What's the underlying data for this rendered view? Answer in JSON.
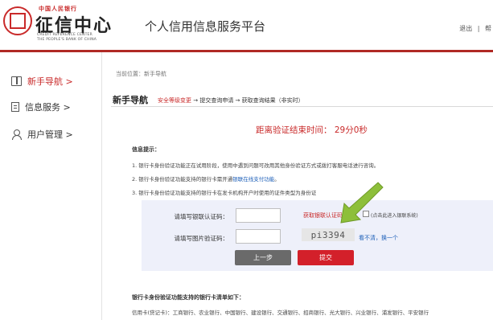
{
  "header": {
    "logo_top": "中国人民银行",
    "logo_cn": "征信中心",
    "logo_en1": "CREDIT REFERENCE CENTER",
    "logo_en2": "THE PEOPLE'S BANK OF CHINA",
    "site_title": "个人信用信息服务平台",
    "links": [
      "退出",
      "|",
      "帮"
    ]
  },
  "sidebar": {
    "items": [
      {
        "label": "新手导航 >",
        "icon": "book-icon",
        "active": true
      },
      {
        "label": "信息服务 >",
        "icon": "document-icon",
        "active": false
      },
      {
        "label": "用户管理 >",
        "icon": "user-icon",
        "active": false
      }
    ]
  },
  "main": {
    "breadcrumb": "当前位置：新手导航",
    "section_title": "新手导航",
    "steps": {
      "current": "安全等级变更",
      "rest": " → 提交查询申请 → 获取查询结果（非实时）"
    },
    "countdown": "距离验证结束时间：  29分0秒",
    "info_head": "信息提示：",
    "info_lines": [
      {
        "text": "1. 银行卡身份验证功能正在试用阶段，使用中遇到问题可改用其他身份验证方式或拨打客服电话进行咨询。"
      },
      {
        "text": "2. 银行卡身份验证功能支持的银行卡需开通",
        "link": "银联在线支付功能",
        "tail": "。"
      },
      {
        "text": "3. 银行卡身份验证功能支持的银行卡在发卡机构开户时使用的证件类型为身份证"
      }
    ],
    "form": {
      "code_label": "请填写银联认证码：",
      "get_code": "获取银联认证码",
      "checkbox_label": "(点击此进入银联系统)",
      "captcha_label": "请填写图片验证码：",
      "captcha_text": "pi3394",
      "captcha_refresh": "看不清，换一个",
      "prev_button": "上一步",
      "submit_button": "提交"
    },
    "banks_head": "银行卡身份验证功能支持的银行卡清单如下：",
    "banks_line": "信用卡(贷记卡)：工商银行、农业银行、中国银行、建设银行、交通银行、招商银行、光大银行、兴业银行、浦发银行、平安银行"
  },
  "colors": {
    "brand_red": "#c92a2a",
    "header_bar": "#b02a25",
    "submit": "#d3202a",
    "arrow": "#8dbf3a",
    "link": "#1d5fb8"
  }
}
